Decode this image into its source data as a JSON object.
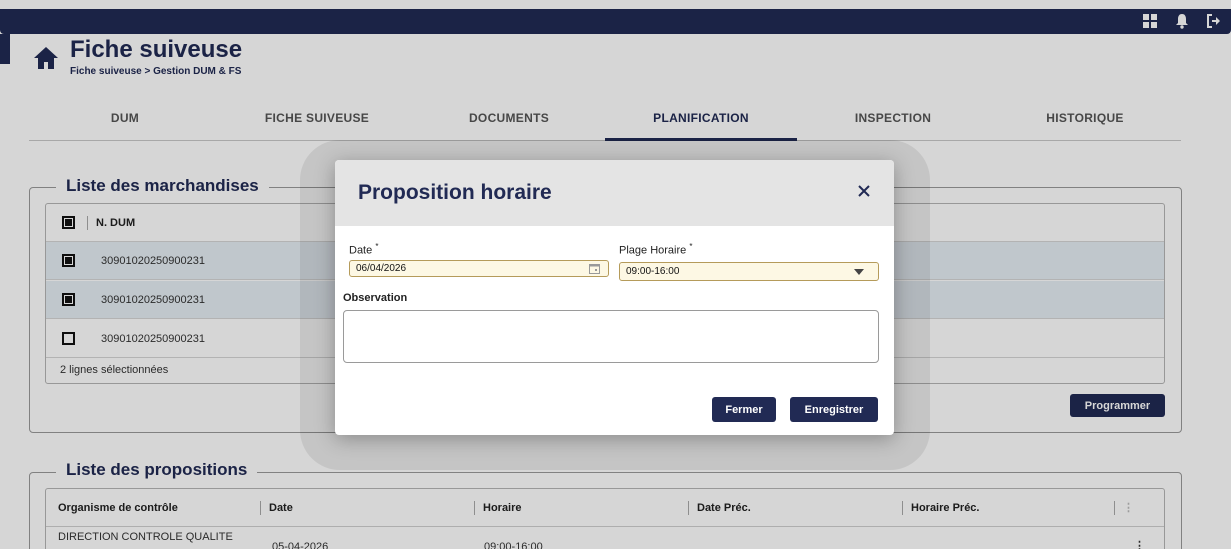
{
  "topbar": {
    "icons": [
      "grid-icon",
      "bell-icon",
      "logout-icon"
    ]
  },
  "header": {
    "title": "Fiche suiveuse",
    "breadcrumb": "Fiche suiveuse > Gestion DUM & FS"
  },
  "tabs": [
    {
      "label": "DUM",
      "active": false
    },
    {
      "label": "FICHE SUIVEUSE",
      "active": false
    },
    {
      "label": "DOCUMENTS",
      "active": false
    },
    {
      "label": "PLANIFICATION",
      "active": true
    },
    {
      "label": "INSPECTION",
      "active": false
    },
    {
      "label": "HISTORIQUE",
      "active": false
    }
  ],
  "marchandises": {
    "legend": "Liste des marchandises",
    "column": "N. DUM",
    "rows": [
      {
        "dum": "30901020250900231",
        "checked": true
      },
      {
        "dum": "30901020250900231",
        "checked": true
      },
      {
        "dum": "30901020250900231",
        "checked": false
      }
    ],
    "footer": "2 lignes sélectionnées",
    "program_button": "Programmer"
  },
  "propositions": {
    "legend": "Liste des propositions",
    "columns": [
      "Organisme de contrôle",
      "Date",
      "Horaire",
      "Date Préc.",
      "Horaire Préc."
    ],
    "rows": [
      {
        "organisme": "DIRECTION CONTROLE QUALITE",
        "date": "05-04-2026",
        "horaire": "09:00-16:00",
        "date_prec": "",
        "horaire_prec": ""
      }
    ]
  },
  "modal": {
    "title": "Proposition horaire",
    "date_label": "Date",
    "date_required": "*",
    "date_value": "06/04/2026",
    "plage_label": "Plage Horaire",
    "plage_required": "*",
    "plage_value": "09:00-16:00",
    "observation_label": "Observation",
    "observation_value": "",
    "close_button": "Fermer",
    "save_button": "Enregistrer"
  },
  "colors": {
    "primary": "#212a54",
    "selected_row": "#e5edf3",
    "input_bg": "#fdf8e4"
  }
}
